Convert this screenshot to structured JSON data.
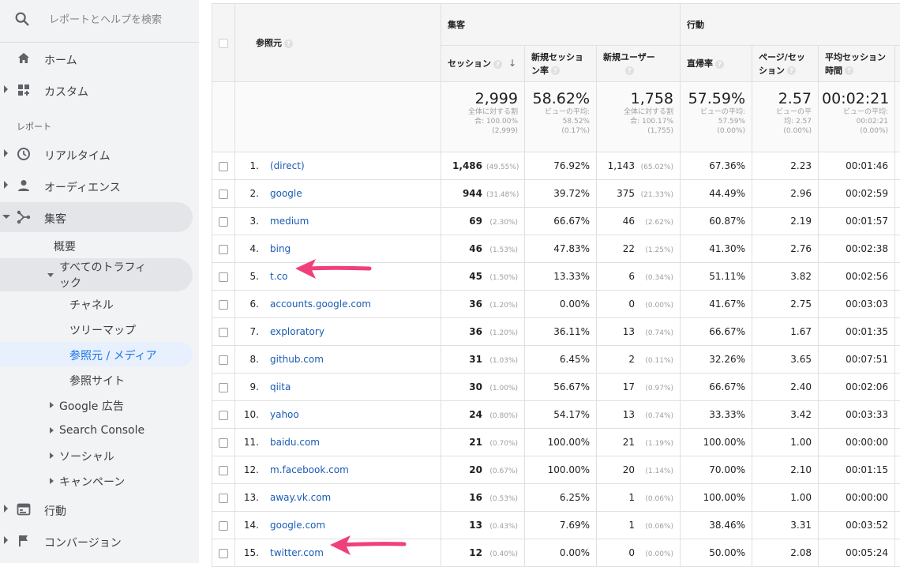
{
  "sidebar": {
    "search_placeholder": "レポートとヘルプを検索",
    "home": "ホーム",
    "custom": "カスタム",
    "reports_label": "レポート",
    "realtime": "リアルタイム",
    "audience": "オーディエンス",
    "acquisition": "集客",
    "overview": "概要",
    "all_traffic_line1": "すべてのトラフィ",
    "all_traffic_line2": "ック",
    "channels": "チャネル",
    "treemap": "ツリーマップ",
    "source_medium": "参照元 / メディア",
    "referrals": "参照サイト",
    "google_ads": "Google 広告",
    "search_console": "Search Console",
    "social": "ソーシャル",
    "campaigns": "キャンペーン",
    "behavior": "行動",
    "conversions": "コンバージョン"
  },
  "table": {
    "dimension_header": "参照元",
    "group_acquisition": "集客",
    "group_behavior": "行動",
    "columns": {
      "sessions": "セッション",
      "new_sessions_l1": "新規セッショ",
      "new_sessions_l2": "ン率",
      "new_users": "新規ユーザー",
      "bounce": "直帰率",
      "pages_l1": "ページ/セッ",
      "pages_l2": "ション",
      "duration_l1": "平均セッション",
      "duration_l2": "時間"
    },
    "totals": {
      "sessions": "2,999",
      "sessions_sub1": "全体に対する割",
      "sessions_sub2": "合: 100.00%",
      "sessions_sub3": "(2,999)",
      "new_sessions": "58.62%",
      "new_sessions_sub1": "ビューの平均:",
      "new_sessions_sub2": "58.52%",
      "new_sessions_sub3": "(0.17%)",
      "new_users": "1,758",
      "new_users_sub1": "全体に対する割",
      "new_users_sub2": "合: 100.17%",
      "new_users_sub3": "(1,755)",
      "bounce": "57.59%",
      "bounce_sub1": "ビューの平均:",
      "bounce_sub2": "57.59%",
      "bounce_sub3": "(0.00%)",
      "pages": "2.57",
      "pages_sub1": "ビューの平",
      "pages_sub2": "均: 2.57",
      "pages_sub3": "(0.00%)",
      "duration": "00:02:21",
      "duration_sub1": "ビューの平均:",
      "duration_sub2": "00:02:21",
      "duration_sub3": "(0.00%)"
    },
    "rows": [
      {
        "idx": "1.",
        "source": "(direct)",
        "sessions": "1,486",
        "sessions_pct": "(49.55%)",
        "new_sessions": "76.92%",
        "new_users": "1,143",
        "new_users_pct": "(65.02%)",
        "bounce": "67.36%",
        "pages": "2.23",
        "duration": "00:01:46"
      },
      {
        "idx": "2.",
        "source": "google",
        "sessions": "944",
        "sessions_pct": "(31.48%)",
        "new_sessions": "39.72%",
        "new_users": "375",
        "new_users_pct": "(21.33%)",
        "bounce": "44.49%",
        "pages": "2.96",
        "duration": "00:02:59"
      },
      {
        "idx": "3.",
        "source": "medium",
        "sessions": "69",
        "sessions_pct": "(2.30%)",
        "new_sessions": "66.67%",
        "new_users": "46",
        "new_users_pct": "(2.62%)",
        "bounce": "60.87%",
        "pages": "2.19",
        "duration": "00:01:57"
      },
      {
        "idx": "4.",
        "source": "bing",
        "sessions": "46",
        "sessions_pct": "(1.53%)",
        "new_sessions": "47.83%",
        "new_users": "22",
        "new_users_pct": "(1.25%)",
        "bounce": "41.30%",
        "pages": "2.76",
        "duration": "00:02:38"
      },
      {
        "idx": "5.",
        "source": "t.co",
        "sessions": "45",
        "sessions_pct": "(1.50%)",
        "new_sessions": "13.33%",
        "new_users": "6",
        "new_users_pct": "(0.34%)",
        "bounce": "51.11%",
        "pages": "3.82",
        "duration": "00:02:56"
      },
      {
        "idx": "6.",
        "source": "accounts.google.com",
        "sessions": "36",
        "sessions_pct": "(1.20%)",
        "new_sessions": "0.00%",
        "new_users": "0",
        "new_users_pct": "(0.00%)",
        "bounce": "41.67%",
        "pages": "2.75",
        "duration": "00:03:03"
      },
      {
        "idx": "7.",
        "source": "exploratory",
        "sessions": "36",
        "sessions_pct": "(1.20%)",
        "new_sessions": "36.11%",
        "new_users": "13",
        "new_users_pct": "(0.74%)",
        "bounce": "66.67%",
        "pages": "1.67",
        "duration": "00:01:35"
      },
      {
        "idx": "8.",
        "source": "github.com",
        "sessions": "31",
        "sessions_pct": "(1.03%)",
        "new_sessions": "6.45%",
        "new_users": "2",
        "new_users_pct": "(0.11%)",
        "bounce": "32.26%",
        "pages": "3.65",
        "duration": "00:07:51"
      },
      {
        "idx": "9.",
        "source": "qiita",
        "sessions": "30",
        "sessions_pct": "(1.00%)",
        "new_sessions": "56.67%",
        "new_users": "17",
        "new_users_pct": "(0.97%)",
        "bounce": "66.67%",
        "pages": "2.40",
        "duration": "00:02:06"
      },
      {
        "idx": "10.",
        "source": "yahoo",
        "sessions": "24",
        "sessions_pct": "(0.80%)",
        "new_sessions": "54.17%",
        "new_users": "13",
        "new_users_pct": "(0.74%)",
        "bounce": "33.33%",
        "pages": "3.42",
        "duration": "00:03:33"
      },
      {
        "idx": "11.",
        "source": "baidu.com",
        "sessions": "21",
        "sessions_pct": "(0.70%)",
        "new_sessions": "100.00%",
        "new_users": "21",
        "new_users_pct": "(1.19%)",
        "bounce": "100.00%",
        "pages": "1.00",
        "duration": "00:00:00"
      },
      {
        "idx": "12.",
        "source": "m.facebook.com",
        "sessions": "20",
        "sessions_pct": "(0.67%)",
        "new_sessions": "100.00%",
        "new_users": "20",
        "new_users_pct": "(1.14%)",
        "bounce": "70.00%",
        "pages": "2.10",
        "duration": "00:01:15"
      },
      {
        "idx": "13.",
        "source": "away.vk.com",
        "sessions": "16",
        "sessions_pct": "(0.53%)",
        "new_sessions": "6.25%",
        "new_users": "1",
        "new_users_pct": "(0.06%)",
        "bounce": "100.00%",
        "pages": "1.00",
        "duration": "00:00:00"
      },
      {
        "idx": "14.",
        "source": "google.com",
        "sessions": "13",
        "sessions_pct": "(0.43%)",
        "new_sessions": "7.69%",
        "new_users": "1",
        "new_users_pct": "(0.06%)",
        "bounce": "38.46%",
        "pages": "3.31",
        "duration": "00:03:52"
      },
      {
        "idx": "15.",
        "source": "twitter.com",
        "sessions": "12",
        "sessions_pct": "(0.40%)",
        "new_sessions": "0.00%",
        "new_users": "0",
        "new_users_pct": "(0.00%)",
        "bounce": "50.00%",
        "pages": "2.08",
        "duration": "00:05:24"
      }
    ]
  },
  "colors": {
    "link": "#1a5bb5",
    "arrow": "#f0407a",
    "selected_bg": "#e8f0fe"
  }
}
